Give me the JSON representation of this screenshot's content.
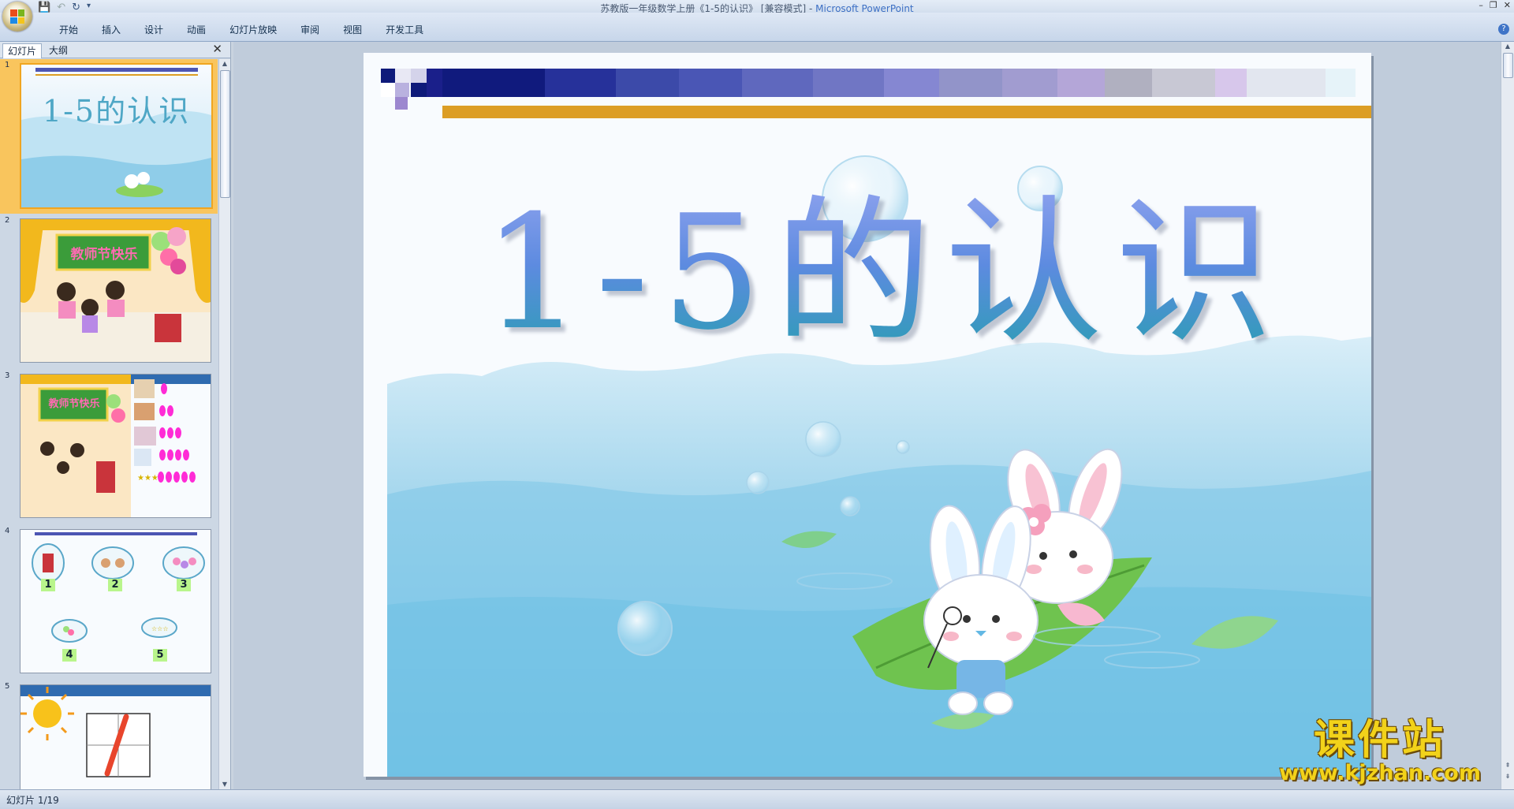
{
  "window": {
    "title_doc": "苏教版一年级数学上册《1-5的认识》 [兼容模式]",
    "title_sep": " - ",
    "title_app": "Microsoft PowerPoint",
    "controls": [
      "–",
      "❐",
      "✕"
    ]
  },
  "qat": {
    "save": "💾",
    "undo": "↶",
    "redo": "↻",
    "more": "▾"
  },
  "ribbon": {
    "tabs": [
      "开始",
      "插入",
      "设计",
      "动画",
      "幻灯片放映",
      "审阅",
      "视图",
      "开发工具"
    ],
    "help": "?"
  },
  "panel": {
    "tab_slides": "幻灯片",
    "tab_outline": "大纲",
    "close": "✕"
  },
  "thumbnails": [
    {
      "number": "1",
      "title": "1-5的认识"
    },
    {
      "number": "2",
      "title": "教师节快乐"
    },
    {
      "number": "3",
      "title": "教师节快乐"
    },
    {
      "number": "4",
      "labels": [
        "1",
        "2",
        "3",
        "4",
        "5"
      ]
    },
    {
      "number": "5"
    }
  ],
  "slide": {
    "title": "1-5的认识"
  },
  "status": {
    "text": "幻灯片 1/19"
  },
  "watermark": {
    "main": "课件站",
    "url": "www.kjzhan.com"
  },
  "colors": {
    "ribbon": "#c7d6ea",
    "canvas": "#c0ccdb",
    "gold_bar": "#dc9e25",
    "title_blue": "#5d8be0"
  }
}
